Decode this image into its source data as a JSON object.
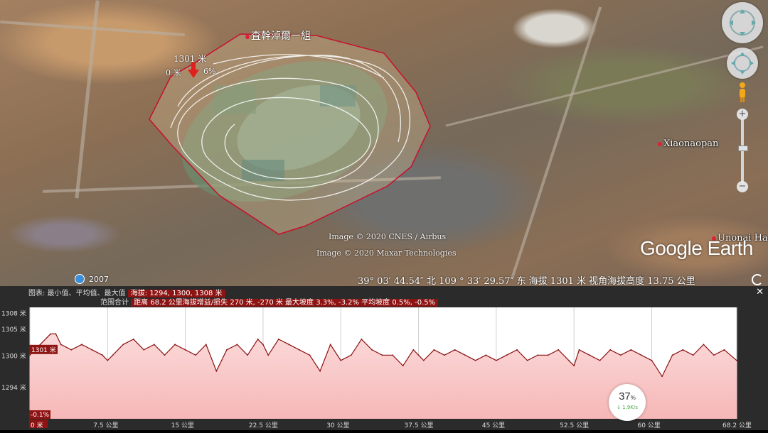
{
  "map": {
    "polygon_name": "査幹淖爾一組",
    "marker_elevation": "1301 米",
    "marker_distance_a": "0 米",
    "marker_distance_b": "6%",
    "places": [
      {
        "name": "Xiaonaopan"
      },
      {
        "name": "Unonai Ha"
      }
    ],
    "credit_1": "Image © 2020 CNES / Airbus",
    "credit_2": "Image © 2020 Maxar Technologies",
    "logo": "Google Earth",
    "imagery_year": "2007",
    "status": "39° 03′ 44.54″ 北 109 ° 33′ 29.57″ 东 海拔  1301 米  视角海拔高度  13.75 公里"
  },
  "profile": {
    "header_prefix": "图表: 最小值、平均值、最大值",
    "elevation_label": "海拔",
    "elevation_values": "1294, 1300, 1308 米",
    "range_label": "范围合计",
    "range_stats": "距离 68.2 公里海拔增益/损失 270 米, -270 米  最大坡度 3.3%, -3.2%  平均坡度 0.5%, -0.5%",
    "y_ticks": [
      "1308 米",
      "1305 米",
      "1300 米",
      "1294 米"
    ],
    "current_value": "1301 米",
    "current_slope": "-0.1%",
    "x_ticks": [
      "0 米",
      "7.5 公里",
      "15 公里",
      "22.5 公里",
      "30 公里",
      "37.5 公里",
      "45 公里",
      "52.5 公里",
      "60 公里",
      "68.2 公里"
    ],
    "progress_percent": "37",
    "progress_unit": "%",
    "progress_speed": "↓ 1.9K/s"
  },
  "colors": {
    "polygon": "#c8102e",
    "profile_line": "#8b1010",
    "profile_fill": "#f6b7b7",
    "highlight": "#8e1313"
  },
  "chart_data": {
    "type": "area",
    "xlabel": "",
    "ylabel": "",
    "x_unit": "公里",
    "y_unit": "米",
    "xlim": [
      0,
      68.2
    ],
    "ylim": [
      1288,
      1309
    ],
    "x_ticks": [
      0,
      7.5,
      15,
      22.5,
      30,
      37.5,
      45,
      52.5,
      60,
      68.2
    ],
    "series": [
      {
        "x": [
          0,
          1,
          2,
          2.5,
          3,
          4,
          5,
          6,
          7,
          7.5,
          8,
          9,
          10,
          11,
          12,
          13,
          14,
          15,
          16,
          17,
          18,
          19,
          20,
          21,
          22,
          22.5,
          23,
          24,
          25,
          26,
          27,
          28,
          29,
          30,
          31,
          32,
          33,
          34,
          35,
          36,
          37,
          37.5,
          38,
          39,
          40,
          41,
          42,
          43,
          44,
          45,
          46,
          47,
          48,
          49,
          50,
          51,
          52,
          52.5,
          53,
          54,
          55,
          56,
          57,
          58,
          59,
          60,
          61,
          62,
          63,
          64,
          65,
          66,
          67,
          68.2
        ],
        "y": [
          1300,
          1302,
          1304,
          1304,
          1302,
          1301,
          1302,
          1301,
          1300,
          1299,
          1300,
          1302,
          1303,
          1301,
          1302,
          1300,
          1302,
          1301,
          1300,
          1302,
          1297,
          1301,
          1302,
          1300,
          1303,
          1302,
          1300,
          1303,
          1302,
          1301,
          1300,
          1297,
          1302,
          1299,
          1300,
          1303,
          1301,
          1300,
          1300,
          1298,
          1301,
          1300,
          1299,
          1301,
          1300,
          1301,
          1300,
          1299,
          1300,
          1299,
          1300,
          1301,
          1299,
          1300,
          1300,
          1301,
          1299,
          1298,
          1301,
          1300,
          1299,
          1301,
          1300,
          1301,
          1300,
          1299,
          1296,
          1300,
          1301,
          1300,
          1302,
          1300,
          1301,
          1299
        ]
      }
    ]
  }
}
